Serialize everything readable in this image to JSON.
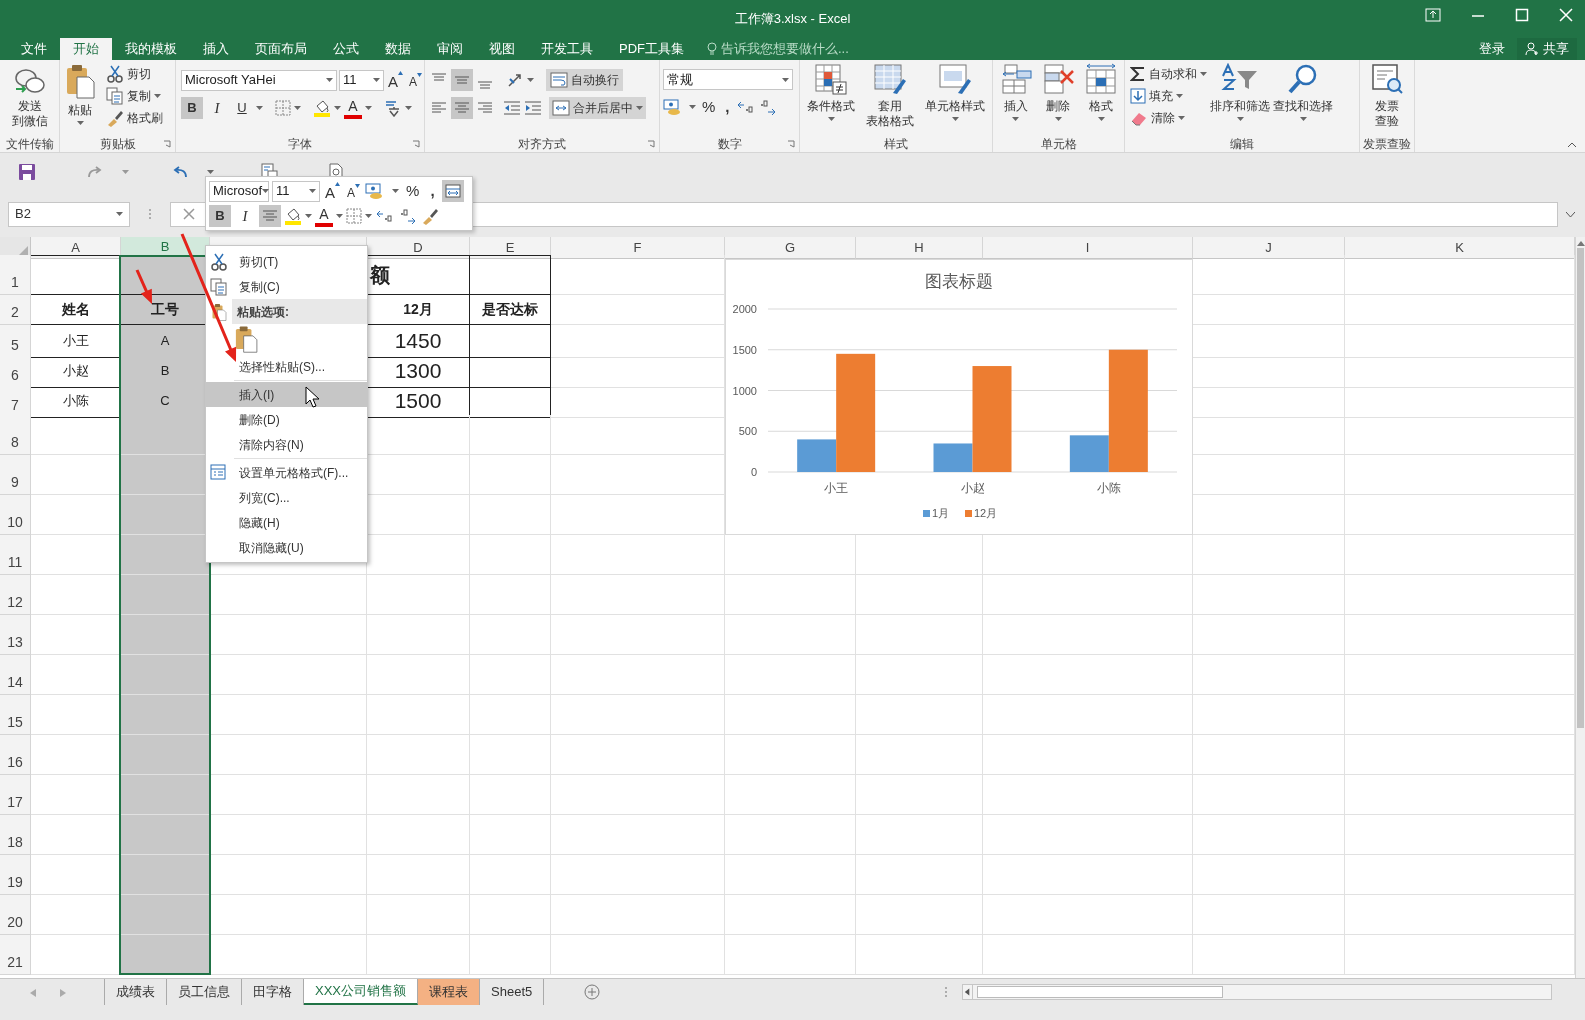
{
  "window": {
    "title": "工作簿3.xlsx - Excel"
  },
  "menu_tabs": [
    {
      "label": "文件",
      "selected": false
    },
    {
      "label": "开始",
      "selected": true
    },
    {
      "label": "我的模板",
      "selected": false
    },
    {
      "label": "插入",
      "selected": false
    },
    {
      "label": "页面布局",
      "selected": false
    },
    {
      "label": "公式",
      "selected": false
    },
    {
      "label": "数据",
      "selected": false
    },
    {
      "label": "审阅",
      "selected": false
    },
    {
      "label": "视图",
      "selected": false
    },
    {
      "label": "开发工具",
      "selected": false
    },
    {
      "label": "PDF工具集",
      "selected": false
    }
  ],
  "tell_me": {
    "placeholder": "告诉我您想要做什么..."
  },
  "account": {
    "sign_in": "登录",
    "share": "共享"
  },
  "ribbon": {
    "groups": [
      {
        "label": "文件传输",
        "buttons": [
          {
            "lines": [
              "发送",
              "到微信"
            ]
          }
        ]
      },
      {
        "label": "剪贴板",
        "buttons": [
          "粘贴",
          "剪切",
          "复制",
          "格式刷"
        ]
      },
      {
        "label": "字体",
        "font": "Microsoft YaHei",
        "size": "11",
        "glyphs": [
          {
            "kind": "grow",
            "text": "A"
          },
          {
            "kind": "shrink",
            "text": "A"
          },
          {
            "kind": "bold",
            "text": "B",
            "on": true
          },
          {
            "kind": "italic",
            "text": "I",
            "on": false
          },
          {
            "kind": "underline",
            "text": "U",
            "on": false
          },
          {
            "kind": "font_color",
            "text": "A"
          }
        ]
      },
      {
        "label": "对齐方式",
        "buttons": [
          "自动换行",
          "合并后居中"
        ],
        "vertical_align": [
          {
            "selected": false
          },
          {
            "selected": true
          },
          {
            "selected": false
          }
        ],
        "horizontal_align": [
          {
            "selected": false
          },
          {
            "selected": true
          },
          {
            "selected": false
          }
        ]
      },
      {
        "label": "数字",
        "format": "常规",
        "glyphs": [
          {
            "kind": "percent",
            "text": "%"
          },
          {
            "kind": "comma",
            "text": ","
          }
        ]
      },
      {
        "label": "样式",
        "buttons": [
          "条件格式",
          {
            "lines": [
              "套用",
              "表格格式"
            ]
          },
          "单元格样式"
        ]
      },
      {
        "label": "单元格",
        "buttons": [
          "插入",
          "删除",
          "格式"
        ]
      },
      {
        "label": "编辑",
        "buttons": [
          "自动求和",
          "填充",
          "清除",
          "排序和筛选",
          "查找和选择"
        ]
      },
      {
        "label": "发票查验",
        "buttons": [
          {
            "lines": [
              "发票",
              "查验"
            ]
          }
        ]
      }
    ]
  },
  "formula_bar": {
    "name_box": "B2"
  },
  "mini_toolbar": {
    "font": "Microsof",
    "size": "11",
    "align_center": true,
    "glyphs": [
      {
        "kind": "grow",
        "text": "A"
      },
      {
        "kind": "shrink",
        "text": "A"
      },
      {
        "kind": "percent",
        "text": "%"
      },
      {
        "kind": "comma",
        "text": ","
      },
      {
        "kind": "bold",
        "text": "B",
        "on": true
      },
      {
        "kind": "italic",
        "text": "I",
        "on": false
      },
      {
        "kind": "font_color",
        "text": "A"
      }
    ]
  },
  "sheet": {
    "columns": [
      {
        "label": "A",
        "selected": false
      },
      {
        "label": "B",
        "selected": true
      },
      {
        "selected": false
      },
      {
        "label": "D",
        "selected": false
      },
      {
        "label": "E",
        "selected": false
      },
      {
        "label": "F",
        "selected": false
      },
      {
        "label": "G",
        "selected": false
      },
      {
        "label": "H",
        "selected": false
      },
      {
        "label": "I",
        "selected": false
      },
      {
        "label": "J",
        "selected": false
      },
      {
        "label": "K",
        "selected": false
      }
    ],
    "rows": [
      {
        "label": "1",
        "kind": "title",
        "cells": {
          "D": "额"
        }
      },
      {
        "label": "2",
        "kind": "header",
        "cells": {
          "A": "姓名",
          "B": "工号",
          "D": "12月",
          "E": "是否达标"
        }
      },
      {
        "label": "5",
        "kind": "data",
        "cells": {
          "A": "小王",
          "B": "A",
          "D": "1450"
        }
      },
      {
        "label": "6",
        "kind": "data",
        "cells": {
          "A": "小赵",
          "B": "B",
          "D": "1300"
        }
      },
      {
        "label": "7",
        "kind": "data",
        "cells": {
          "A": "小陈",
          "B": "C",
          "D": "1500"
        }
      },
      {
        "label": "8",
        "kind": "empty"
      },
      {
        "label": "9",
        "kind": "empty"
      },
      {
        "label": "10",
        "kind": "empty"
      },
      {
        "label": "11",
        "kind": "empty"
      },
      {
        "label": "12",
        "kind": "empty"
      },
      {
        "label": "13",
        "kind": "empty"
      },
      {
        "label": "14",
        "kind": "empty"
      },
      {
        "label": "15",
        "kind": "empty"
      },
      {
        "label": "16",
        "kind": "empty"
      },
      {
        "label": "17",
        "kind": "empty"
      },
      {
        "label": "18",
        "kind": "empty"
      },
      {
        "label": "19",
        "kind": "empty"
      },
      {
        "label": "20",
        "kind": "empty"
      },
      {
        "label": "21",
        "kind": "empty"
      }
    ]
  },
  "chart": {
    "chart_data": {
      "type": "bar",
      "title": "图表标题",
      "categories": [
        "小王",
        "小赵",
        "小陈"
      ],
      "series": [
        {
          "name": "1月",
          "color": "#5b9bd5",
          "values": [
            400,
            350,
            450
          ]
        },
        {
          "name": "12月",
          "color": "#ed7d31",
          "values": [
            1450,
            1300,
            1500
          ]
        }
      ],
      "ylim": [
        0,
        2000
      ],
      "yticks": [
        {
          "value": 0,
          "label": "0"
        },
        {
          "value": 500,
          "label": "500"
        },
        {
          "value": 1000,
          "label": "1000"
        },
        {
          "value": 1500,
          "label": "1500"
        },
        {
          "value": 2000,
          "label": "2000"
        }
      ],
      "grid": true,
      "legend": true
    }
  },
  "context_menu": {
    "items": [
      {
        "kind": "command",
        "label": "剪切(T)",
        "selected": false
      },
      {
        "kind": "command",
        "label": "复制(C)",
        "selected": false
      },
      {
        "kind": "section",
        "label": "粘贴选项:"
      },
      {
        "kind": "paste_options"
      },
      {
        "kind": "command",
        "label": "选择性粘贴(S)...",
        "selected": false
      },
      {
        "kind": "separator"
      },
      {
        "kind": "command",
        "label": "插入(I)",
        "selected": true
      },
      {
        "kind": "command",
        "label": "删除(D)",
        "selected": false
      },
      {
        "kind": "command",
        "label": "清除内容(N)",
        "selected": false
      },
      {
        "kind": "separator"
      },
      {
        "kind": "command",
        "label": "设置单元格格式(F)...",
        "selected": false
      },
      {
        "kind": "command",
        "label": "列宽(C)...",
        "selected": false
      },
      {
        "kind": "command",
        "label": "隐藏(H)",
        "selected": false
      },
      {
        "kind": "command",
        "label": "取消隐藏(U)",
        "selected": false
      }
    ]
  },
  "sheet_tabs": [
    {
      "label": "成绩表",
      "selected": false
    },
    {
      "label": "员工信息",
      "selected": false
    },
    {
      "label": "田字格",
      "selected": false
    },
    {
      "label": "XXX公司销售额",
      "selected": true
    },
    {
      "label": "课程表",
      "selected": false,
      "color": "#f4b183"
    },
    {
      "label": "Sheet5",
      "selected": false
    }
  ]
}
